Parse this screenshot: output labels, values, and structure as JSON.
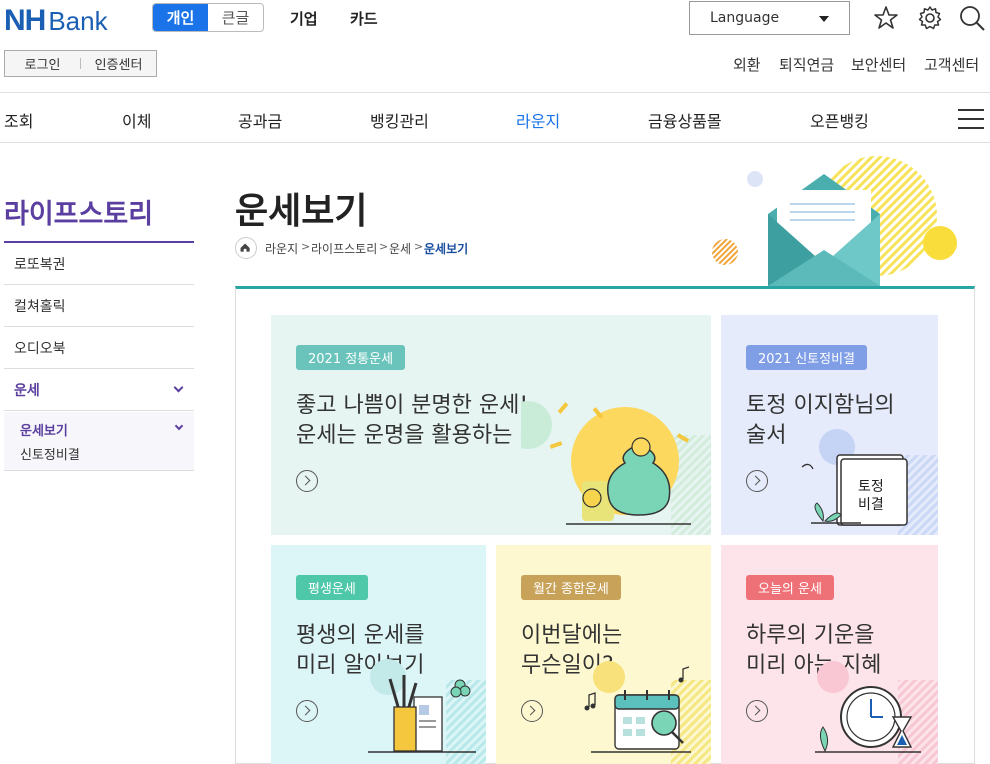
{
  "header": {
    "logo_nh": "NH",
    "logo_bank": "Bank",
    "segments": [
      "개인",
      "큰글"
    ],
    "links": [
      "기업",
      "카드"
    ],
    "language_label": "Language"
  },
  "auth": {
    "login": "로그인",
    "cert": "인증센터"
  },
  "util_links": [
    "외환",
    "퇴직연금",
    "보안센터",
    "고객센터"
  ],
  "gnb": [
    "조회",
    "이체",
    "공과금",
    "뱅킹관리",
    "라운지",
    "금융상품몰",
    "오픈뱅킹"
  ],
  "sidebar": {
    "title": "라이프스토리",
    "items": [
      "로또복권",
      "컬쳐홀릭",
      "오디오북",
      "운세"
    ],
    "sub_items": [
      "운세보기",
      "신토정비결"
    ]
  },
  "page": {
    "title": "운세보기",
    "breadcrumb": [
      "라운지",
      "라이프스토리",
      "운세",
      "운세보기"
    ]
  },
  "cards": [
    {
      "tag": "2021 정통운세",
      "line1": "좋고 나쁨이 분명한 운세!",
      "line2": "운세는 운명을 활용하는 것",
      "color": "#6ac4bc",
      "bg": "#e6f5f1"
    },
    {
      "tag": "2021 신토정비결",
      "line1": "토정 이지함님의",
      "line2": "술서",
      "color": "#7f9ee6",
      "bg": "#e5ebfb",
      "illus_line1": "토정",
      "illus_line2": "비결"
    },
    {
      "tag": "평생운세",
      "line1": "평생의 운세를",
      "line2": "미리 알아보기",
      "color": "#4fc7a9",
      "bg": "#dcf5f7"
    },
    {
      "tag": "월간 종합운세",
      "line1": "이번달에는",
      "line2": "무슨일이?",
      "color": "#c9a25a",
      "bg": "#fdf8cf"
    },
    {
      "tag": "오늘의 운세",
      "line1": "하루의 기운을",
      "line2": "미리 아는 지혜",
      "color": "#ef7178",
      "bg": "#fde4ea"
    }
  ],
  "colors": {
    "brand": "#1a5fb4",
    "accent": "#1a73e8",
    "sidebar": "#5b3fa0",
    "panel_top": "#2aa5a5"
  }
}
